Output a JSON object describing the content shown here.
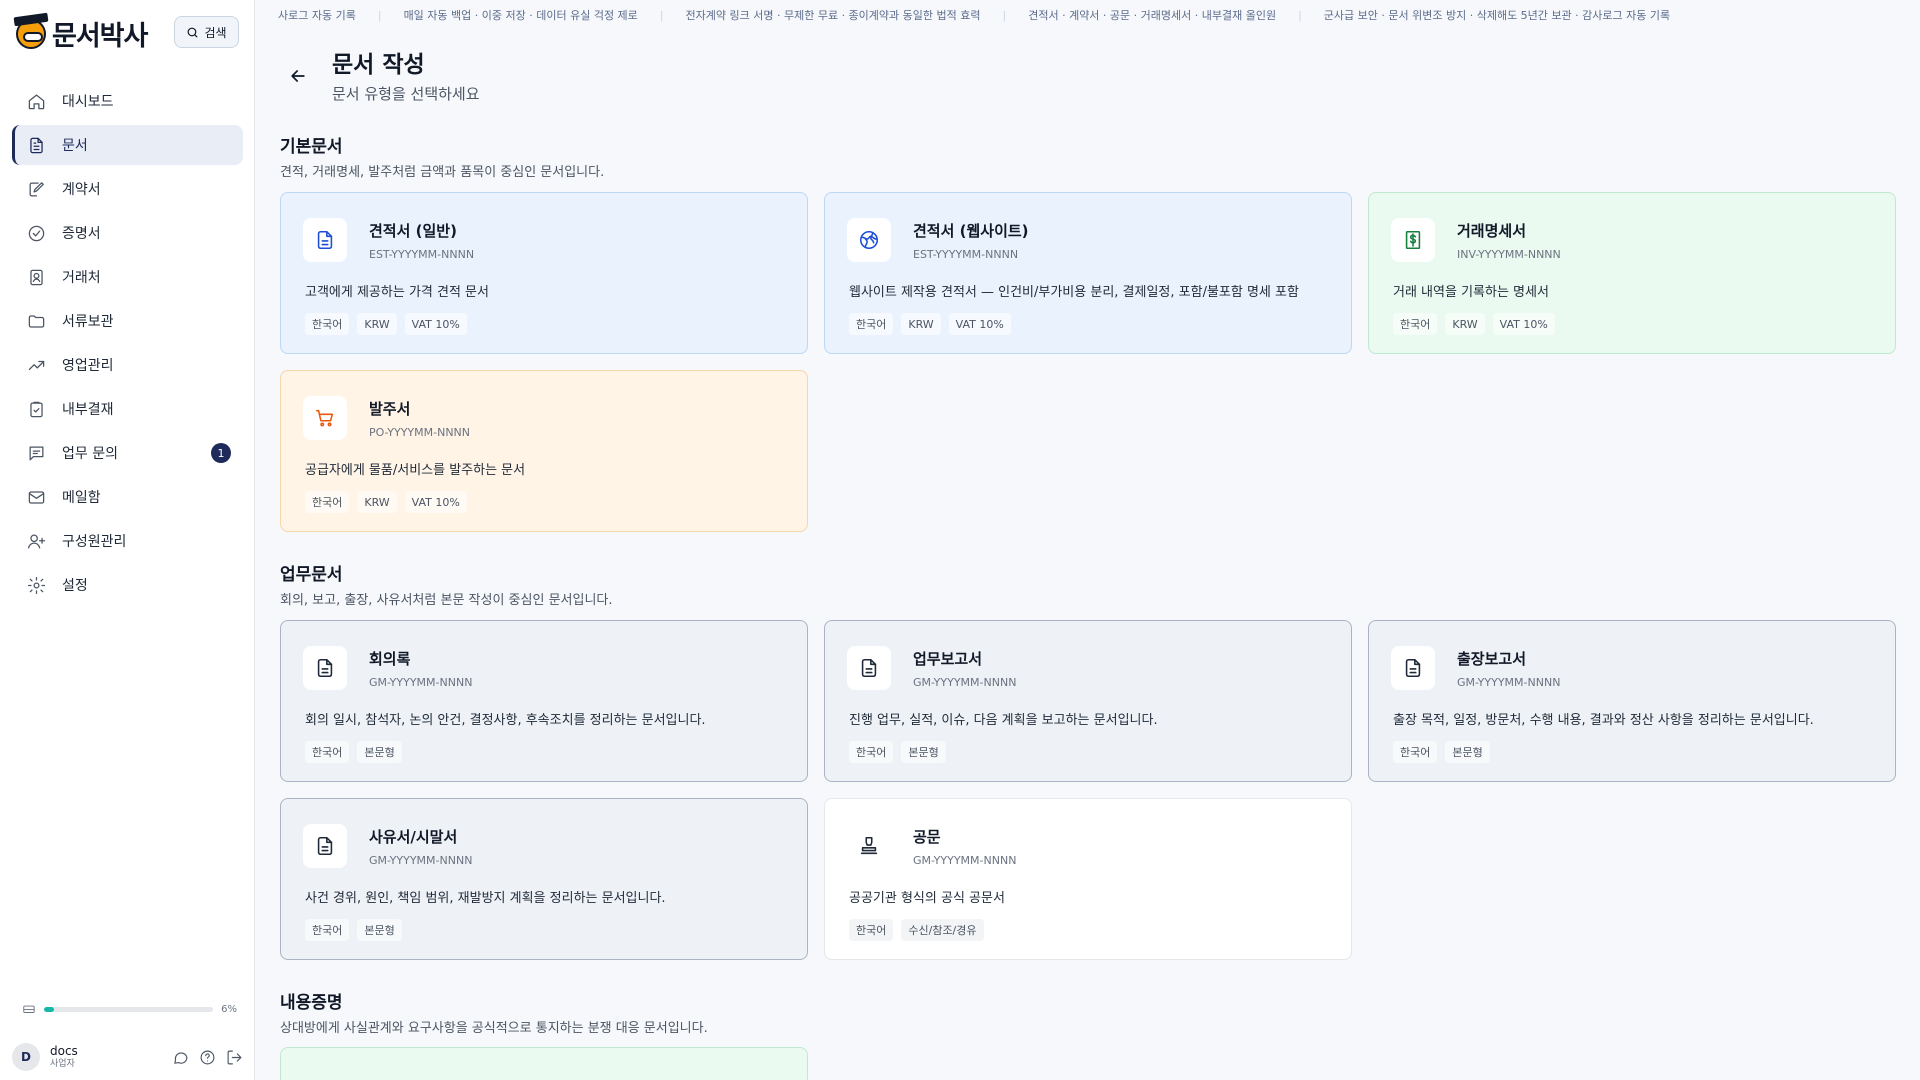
{
  "brand": {
    "name": "문서박사"
  },
  "search": {
    "label": "검색"
  },
  "sidebar": {
    "items": [
      {
        "label": "대시보드",
        "icon": "home-icon"
      },
      {
        "label": "문서",
        "icon": "document-icon",
        "active": true
      },
      {
        "label": "계약서",
        "icon": "edit-document-icon"
      },
      {
        "label": "증명서",
        "icon": "check-circle-icon"
      },
      {
        "label": "거래처",
        "icon": "contact-book-icon"
      },
      {
        "label": "서류보관",
        "icon": "folder-icon"
      },
      {
        "label": "영업관리",
        "icon": "trending-up-icon"
      },
      {
        "label": "내부결재",
        "icon": "clipboard-check-icon"
      },
      {
        "label": "업무 문의",
        "icon": "message-icon",
        "badge": "1"
      },
      {
        "label": "메일함",
        "icon": "mail-icon"
      },
      {
        "label": "구성원관리",
        "icon": "user-plus-icon"
      },
      {
        "label": "설정",
        "icon": "gear-icon"
      }
    ],
    "storage": {
      "percent_label": "6%",
      "fraction": 0.06
    },
    "user": {
      "initial": "D",
      "name": "docs",
      "role": "사업자"
    }
  },
  "ticker": [
    "사로그 자동 기록",
    "매일 자동 백업 · 이중 저장 · 데이터 유실 걱정 제로",
    "전자계약 링크 서명 · 무제한 무료 · 종이계약과 동일한 법적 효력",
    "견적서 · 계약서 · 공문 · 거래명세서 · 내부결재 올인원",
    "군사급 보안 · 문서 위변조 방지 · 삭제해도 5년간 보관 · 감사로그 자동 기록"
  ],
  "header": {
    "title": "문서 작성",
    "subtitle": "문서 유형을 선택하세요"
  },
  "sections": [
    {
      "title": "기본문서",
      "desc": "견적, 거래명세, 발주처럼 금액과 품목이 중심인 문서입니다.",
      "cards": [
        {
          "title": "견적서 (일반)",
          "code": "EST-YYYYMM-NNNN",
          "desc": "고객에게 제공하는 가격 견적 문서",
          "tags": [
            "한국어",
            "KRW",
            "VAT 10%"
          ],
          "icon": "document-icon",
          "color": "#1d4ed8",
          "theme": "blue"
        },
        {
          "title": "견적서 (웹사이트)",
          "code": "EST-YYYYMM-NNNN",
          "desc": "웹사이트 제작용 견적서 — 인건비/부가비용 분리, 결제일정, 포함/불포함 명세 포함",
          "tags": [
            "한국어",
            "KRW",
            "VAT 10%"
          ],
          "icon": "globe-icon",
          "color": "#1d4ed8",
          "theme": "blue"
        },
        {
          "title": "거래명세서",
          "code": "INV-YYYYMM-NNNN",
          "desc": "거래 내역을 기록하는 명세서",
          "tags": [
            "한국어",
            "KRW",
            "VAT 10%"
          ],
          "icon": "dollar-document-icon",
          "color": "#15803d",
          "theme": "green"
        },
        {
          "title": "발주서",
          "code": "PO-YYYYMM-NNNN",
          "desc": "공급자에게 물품/서비스를 발주하는 문서",
          "tags": [
            "한국어",
            "KRW",
            "VAT 10%"
          ],
          "icon": "cart-icon",
          "color": "#ea580c",
          "theme": "orange"
        }
      ]
    },
    {
      "title": "업무문서",
      "desc": "회의, 보고, 출장, 사유서처럼 본문 작성이 중심인 문서입니다.",
      "cards": [
        {
          "title": "회의록",
          "code": "GM-YYYYMM-NNNN",
          "desc": "회의 일시, 참석자, 논의 안건, 결정사항, 후속조치를 정리하는 문서입니다.",
          "tags": [
            "한국어",
            "본문형"
          ],
          "icon": "document-icon",
          "color": "#1f2937",
          "theme": "gray"
        },
        {
          "title": "업무보고서",
          "code": "GM-YYYYMM-NNNN",
          "desc": "진행 업무, 실적, 이슈, 다음 계획을 보고하는 문서입니다.",
          "tags": [
            "한국어",
            "본문형"
          ],
          "icon": "document-icon",
          "color": "#1f2937",
          "theme": "gray"
        },
        {
          "title": "출장보고서",
          "code": "GM-YYYYMM-NNNN",
          "desc": "출장 목적, 일정, 방문처, 수행 내용, 결과와 정산 사항을 정리하는 문서입니다.",
          "tags": [
            "한국어",
            "본문형"
          ],
          "icon": "document-icon",
          "color": "#1f2937",
          "theme": "gray"
        },
        {
          "title": "사유서/시말서",
          "code": "GM-YYYYMM-NNNN",
          "desc": "사건 경위, 원인, 책임 범위, 재발방지 계획을 정리하는 문서입니다.",
          "tags": [
            "한국어",
            "본문형"
          ],
          "icon": "document-icon",
          "color": "#1f2937",
          "theme": "gray"
        },
        {
          "title": "공문",
          "code": "GM-YYYYMM-NNNN",
          "desc": "공공기관 형식의 공식 공문서",
          "tags": [
            "한국어",
            "수신/참조/경유"
          ],
          "icon": "stamp-icon",
          "color": "#1f2937",
          "theme": "white"
        }
      ]
    },
    {
      "title": "내용증명",
      "desc": "상대방에게 사실관계와 요구사항을 공식적으로 통지하는 분쟁 대응 문서입니다.",
      "cards": []
    }
  ]
}
